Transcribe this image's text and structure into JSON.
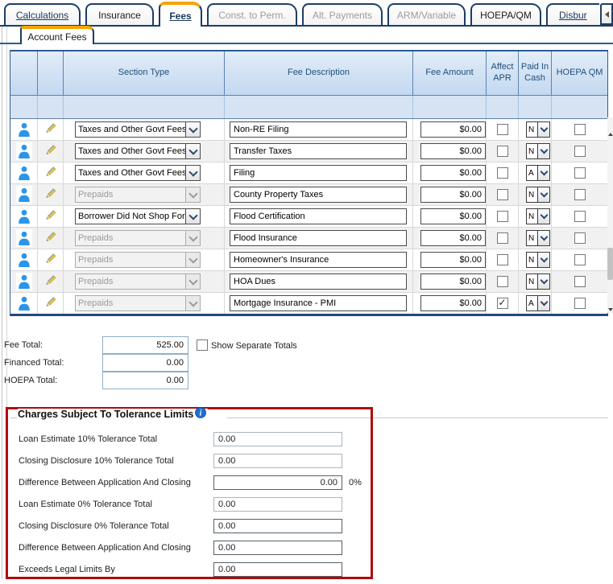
{
  "tabs": {
    "items": [
      {
        "label": "Calculations"
      },
      {
        "label": "Insurance"
      },
      {
        "label": "Fees"
      },
      {
        "label": "Const. to Perm."
      },
      {
        "label": "Alt. Payments"
      },
      {
        "label": "ARM/Variable"
      },
      {
        "label": "HOEPA/QM"
      },
      {
        "label": "Disbur"
      }
    ],
    "scroll_left_icon": "left-arrow"
  },
  "subtab": {
    "label": "Account Fees"
  },
  "fees_table": {
    "columns": [
      "",
      "",
      "Section Type",
      "Fee Description",
      "Fee Amount",
      "Affect APR",
      "Paid In Cash",
      "HOEPA QM"
    ],
    "row_icons": [
      "person-icon",
      "pencil-icon"
    ],
    "rows": [
      {
        "section": "Taxes and Other Govt Fees",
        "section_enabled": true,
        "description": "Non-RE Filing",
        "amount": "$0.00",
        "affect_apr": false,
        "paid_in_cash": "N",
        "hoepa_qm": false
      },
      {
        "section": "Taxes and Other Govt Fees",
        "section_enabled": true,
        "description": "Transfer Taxes",
        "amount": "$0.00",
        "affect_apr": false,
        "paid_in_cash": "N",
        "hoepa_qm": false
      },
      {
        "section": "Taxes and Other Govt Fees",
        "section_enabled": true,
        "description": "Filing",
        "amount": "$0.00",
        "affect_apr": false,
        "paid_in_cash": "A",
        "hoepa_qm": false
      },
      {
        "section": "Prepaids",
        "section_enabled": false,
        "description": "County Property Taxes",
        "amount": "$0.00",
        "affect_apr": false,
        "paid_in_cash": "N",
        "hoepa_qm": false
      },
      {
        "section": "Borrower Did Not Shop For",
        "section_enabled": true,
        "description": "Flood Certification",
        "amount": "$0.00",
        "affect_apr": false,
        "paid_in_cash": "N",
        "hoepa_qm": false
      },
      {
        "section": "Prepaids",
        "section_enabled": false,
        "description": "Flood Insurance",
        "amount": "$0.00",
        "affect_apr": false,
        "paid_in_cash": "N",
        "hoepa_qm": false
      },
      {
        "section": "Prepaids",
        "section_enabled": false,
        "description": "Homeowner's Insurance",
        "amount": "$0.00",
        "affect_apr": false,
        "paid_in_cash": "N",
        "hoepa_qm": false
      },
      {
        "section": "Prepaids",
        "section_enabled": false,
        "description": "HOA Dues",
        "amount": "$0.00",
        "affect_apr": false,
        "paid_in_cash": "N",
        "hoepa_qm": false
      },
      {
        "section": "Prepaids",
        "section_enabled": false,
        "description": "Mortgage Insurance - PMI",
        "amount": "$0.00",
        "affect_apr": true,
        "paid_in_cash": "A",
        "hoepa_qm": false
      }
    ]
  },
  "totals": {
    "fee_total_label": "Fee Total:",
    "fee_total_value": "525.00",
    "financed_total_label": "Financed Total:",
    "financed_total_value": "0.00",
    "hoepa_total_label": "HOEPA Total:",
    "hoepa_total_value": "0.00",
    "show_separate_label": "Show Separate Totals",
    "show_separate_checked": false
  },
  "tolerance": {
    "title": "Charges Subject To Tolerance Limits",
    "info_icon": "info-icon",
    "fields": [
      {
        "label": "Loan Estimate 10% Tolerance Total",
        "value": "0.00",
        "suffix": ""
      },
      {
        "label": "Closing Disclosure 10% Tolerance Total",
        "value": "0.00",
        "suffix": ""
      },
      {
        "label": "Difference Between Application And Closing",
        "value": "0.00",
        "suffix": "0%"
      },
      {
        "label": "Loan Estimate 0% Tolerance Total",
        "value": "0.00",
        "suffix": ""
      },
      {
        "label": "Closing Disclosure 0% Tolerance Total",
        "value": "0.00",
        "suffix": ""
      },
      {
        "label": "Difference Between Application And Closing",
        "value": "0.00",
        "suffix": ""
      },
      {
        "label": "Exceeds Legal Limits By",
        "value": "0.00",
        "suffix": ""
      }
    ]
  },
  "colors": {
    "accent_orange": "#F7A300",
    "tab_border_navy": "#1C3E67",
    "header_text_blue": "#1F4E79",
    "table_border_blue": "#2E5C94",
    "red_highlight_box": "#B00B0B",
    "person_icon_blue": "#2B95E9",
    "alt_row_gray": "#F1F1F1"
  }
}
